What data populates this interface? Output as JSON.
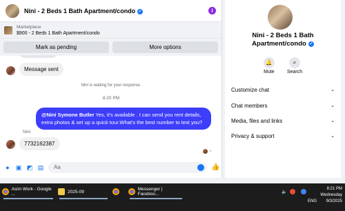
{
  "header": {
    "title": "Nini - 2 Beds 1 Bath Apartment/condo",
    "info_icon": "info-icon"
  },
  "listing": {
    "source": "Marketplace",
    "title": "$900 - 2 Beds 1 Bath Apartment/condo"
  },
  "actions": {
    "pending_label": "Mark as pending",
    "more_label": "More options"
  },
  "messages": {
    "m1": "Message sent",
    "system": "Nini is waiting for your response.",
    "time": "8:20 PM",
    "outgoing_mention": "@Nini Symone Butler",
    "outgoing_text": " Yes, it's available .  I can send you rent details, extra photos & set up a quick tour.What's the best number to text you?",
    "sender": "Nini",
    "reply": "7732162387"
  },
  "composer": {
    "placeholder": "Aa"
  },
  "info": {
    "name": "Nini - 2 Beds 1 Bath Apartment/condo",
    "mute_label": "Mute",
    "search_label": "Search",
    "rows": [
      "Customize chat",
      "Chat members",
      "Media, files and links",
      "Privacy & support"
    ]
  },
  "taskbar": {
    "items": [
      "Asim Work - Google ...",
      "2025-09",
      "",
      "Messenger | Faceboo..."
    ],
    "lang": "ENG",
    "time": "8:21 PM",
    "day": "Wednesday",
    "date": "9/3/2025"
  },
  "colors": {
    "accent": "#1877f2",
    "outgoing_bubble": "#3d3dfa"
  }
}
